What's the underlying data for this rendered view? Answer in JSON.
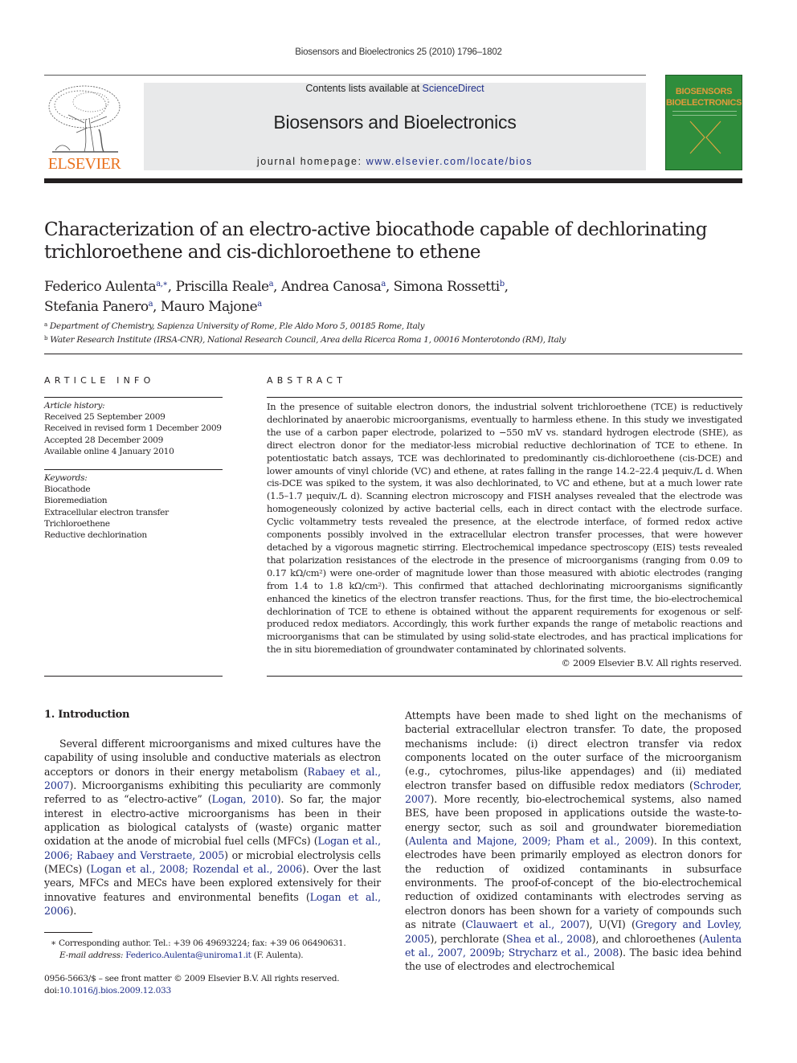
{
  "running_head": "Biosensors and Bioelectronics 25 (2010) 1796–1802",
  "masthead": {
    "publisher_logo_text": "ELSEVIER",
    "contents_prefix": "Contents lists available at ",
    "contents_link": "ScienceDirect",
    "journal_title": "Biosensors and Bioelectronics",
    "homepage_prefix": "journal homepage: ",
    "homepage_link": "www.elsevier.com/locate/bios",
    "cover_line1": "BIOSENSORS",
    "cover_line2": "BIOELECTRONICS"
  },
  "article": {
    "title": "Characterization of an electro-active biocathode capable of dechlorinating trichloroethene and cis-dichloroethene to ethene",
    "authors": [
      {
        "name": "Federico Aulenta",
        "sup": "a,∗",
        "sep": ", "
      },
      {
        "name": "Priscilla Reale",
        "sup": "a",
        "sep": ", "
      },
      {
        "name": "Andrea Canosa",
        "sup": "a",
        "sep": ", "
      },
      {
        "name": "Simona Rossetti",
        "sup": "b",
        "sep": ","
      },
      {
        "name": "Stefania Panero",
        "sup": "a",
        "sep": ", "
      },
      {
        "name": "Mauro Majone",
        "sup": "a",
        "sep": ""
      }
    ],
    "affiliations": [
      {
        "key": "a",
        "text": "Department of Chemistry, Sapienza University of Rome, P.le Aldo Moro 5, 00185 Rome, Italy"
      },
      {
        "key": "b",
        "text": "Water Research Institute (IRSA-CNR), National Research Council, Area della Ricerca Roma 1, 00016 Monterotondo (RM), Italy"
      }
    ]
  },
  "article_info": {
    "heading": "ARTICLE INFO",
    "history_label": "Article history:",
    "history": [
      "Received 25 September 2009",
      "Received in revised form 1 December 2009",
      "Accepted 28 December 2009",
      "Available online 4 January 2010"
    ],
    "keywords_label": "Keywords:",
    "keywords": [
      "Biocathode",
      "Bioremediation",
      "Extracellular electron transfer",
      "Trichloroethene",
      "Reductive dechlorination"
    ]
  },
  "abstract": {
    "heading": "ABSTRACT",
    "text": "In the presence of suitable electron donors, the industrial solvent trichloroethene (TCE) is reductively dechlorinated by anaerobic microorganisms, eventually to harmless ethene. In this study we investigated the use of a carbon paper electrode, polarized to −550 mV vs. standard hydrogen electrode (SHE), as direct electron donor for the mediator-less microbial reductive dechlorination of TCE to ethene. In potentiostatic batch assays, TCE was dechlorinated to predominantly cis-dichloroethene (cis-DCE) and lower amounts of vinyl chloride (VC) and ethene, at rates falling in the range 14.2–22.4 μequiv./L d. When cis-DCE was spiked to the system, it was also dechlorinated, to VC and ethene, but at a much lower rate (1.5–1.7 μequiv./L d). Scanning electron microscopy and FISH analyses revealed that the electrode was homogeneously colonized by active bacterial cells, each in direct contact with the electrode surface. Cyclic voltammetry tests revealed the presence, at the electrode interface, of formed redox active components possibly involved in the extracellular electron transfer processes, that were however detached by a vigorous magnetic stirring. Electrochemical impedance spectroscopy (EIS) tests revealed that polarization resistances of the electrode in the presence of microorganisms (ranging from 0.09 to 0.17 kΩ/cm²) were one-order of magnitude lower than those measured with abiotic electrodes (ranging from 1.4 to 1.8 kΩ/cm²). This confirmed that attached dechlorinating microorganisms significantly enhanced the kinetics of the electron transfer reactions. Thus, for the first time, the bio-electrochemical dechlorination of TCE to ethene is obtained without the apparent requirements for exogenous or self-produced redox mediators. Accordingly, this work further expands the range of metabolic reactions and microorganisms that can be stimulated by using solid-state electrodes, and has practical implications for the in situ bioremediation of groundwater contaminated by chlorinated solvents.",
    "copyright": "© 2009 Elsevier B.V. All rights reserved."
  },
  "introduction": {
    "heading": "1.  Introduction",
    "left_column": [
      {
        "t": "Several different microorganisms and mixed cultures have the capability of using insoluble and conductive materials as electron acceptors or donors in their energy metabolism ("
      },
      {
        "t": "Rabaey et al., 2007",
        "link": true
      },
      {
        "t": "). Microorganisms exhibiting this peculiarity are commonly referred to as “electro-active” ("
      },
      {
        "t": "Logan, 2010",
        "link": true
      },
      {
        "t": "). So far, the major interest in electro-active microorganisms has been in their application as biological catalysts of (waste) organic matter oxidation at the anode of microbial fuel cells (MFCs) ("
      },
      {
        "t": "Logan et al., 2006; Rabaey and Verstraete, 2005",
        "link": true
      },
      {
        "t": ") or microbial electrolysis cells (MECs) ("
      },
      {
        "t": "Logan et al., 2008; Rozendal et al., 2006",
        "link": true
      },
      {
        "t": "). Over the last years, MFCs and MECs have been explored extensively for their innovative features and environmental benefits ("
      },
      {
        "t": "Logan et al., 2006",
        "link": true
      },
      {
        "t": ")."
      }
    ],
    "right_column": [
      {
        "t": "Attempts have been made to shed light on the mechanisms of bacterial extracellular electron transfer. To date, the proposed mechanisms include: (i) direct electron transfer via redox components located on the outer surface of the microorganism (e.g., cytochromes, pilus-like appendages) and (ii) mediated electron transfer based on diffusible redox mediators ("
      },
      {
        "t": "Schroder, 2007",
        "link": true
      },
      {
        "t": "). More recently, bio-electrochemical systems, also named BES, have been proposed in applications outside the waste-to-energy sector, such as soil and groundwater bioremediation ("
      },
      {
        "t": "Aulenta and Majone, 2009; Pham et al., 2009",
        "link": true
      },
      {
        "t": "). In this context, electrodes have been primarily employed as electron donors for the reduction of oxidized contaminants in subsurface environments. The proof-of-concept of the bio-electrochemical reduction of oxidized contaminants with electrodes serving as electron donors has been shown for a variety of compounds such as nitrate ("
      },
      {
        "t": "Clauwaert et al., 2007",
        "link": true
      },
      {
        "t": "), U(VI) ("
      },
      {
        "t": "Gregory and Lovley, 2005",
        "link": true
      },
      {
        "t": "), perchlorate ("
      },
      {
        "t": "Shea et al., 2008",
        "link": true
      },
      {
        "t": "), and chloroethenes ("
      },
      {
        "t": "Aulenta et al., 2007, 2009b; Strycharz et al., 2008",
        "link": true
      },
      {
        "t": "). The basic idea behind the use of electrodes and electrochemical"
      }
    ]
  },
  "footnotes": {
    "corresponding_marker": "∗",
    "corresponding": "Corresponding author. Tel.: +39 06 49693224; fax: +39 06 06490631.",
    "email_label": "E-mail address:",
    "email": "Federico.Aulenta@uniroma1.it",
    "email_suffix": " (F. Aulenta).",
    "front_matter": "0956-5663/$ – see front matter © 2009 Elsevier B.V. All rights reserved.",
    "doi_label": "doi:",
    "doi": "10.1016/j.bios.2009.12.033"
  },
  "colors": {
    "link": "#1f2f8a",
    "elsevier_orange": "#e9711c",
    "cover_green": "#2f8d3c",
    "banner_gray": "#e8e9ea"
  }
}
